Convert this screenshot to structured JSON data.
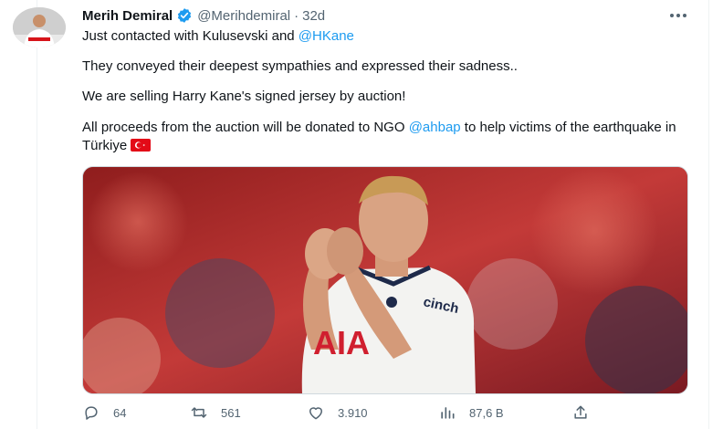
{
  "tweet": {
    "author_name": "Merih Demiral",
    "handle": "@Merihdemiral",
    "separator": "·",
    "time": "32d",
    "line1_prefix": "Just contacted with Kulusevski and ",
    "line1_mention": "@HKane",
    "line2": "They conveyed their deepest sympathies and expressed their sadness..",
    "line3": "We are selling Harry Kane's signed jersey by auction!",
    "line4_prefix": "All proceeds from the auction will be donated to NGO ",
    "line4_mention": "@ahbap",
    "line4_suffix": " to help victims of the earthquake in Türkiye"
  },
  "icons": {
    "verified": "verified-badge-icon",
    "more": "more-dots-icon",
    "flag": "turkey-flag-icon",
    "reply": "reply-icon",
    "retweet": "retweet-icon",
    "like": "heart-icon",
    "views": "views-chart-icon",
    "share": "share-icon"
  },
  "actions": {
    "replies": "64",
    "retweets": "561",
    "likes": "3.910",
    "views": "87,6 B"
  },
  "colors": {
    "link": "#1d9bf0",
    "muted": "#536471",
    "verified": "#1d9bf0",
    "flag_red": "#e30a17"
  }
}
